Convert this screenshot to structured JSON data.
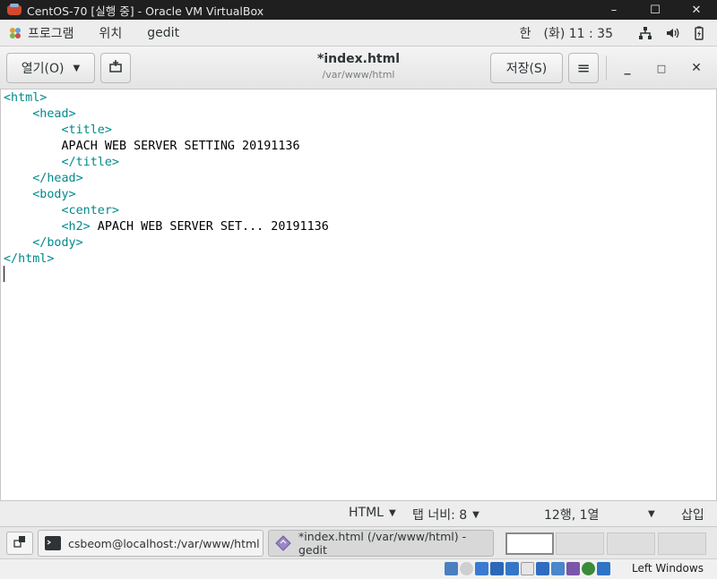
{
  "vbox": {
    "title": "CentOS-70 [실행 중] - Oracle VM VirtualBox",
    "minimize": "–",
    "maximize": "☐",
    "close": "✕"
  },
  "gnome_topbar": {
    "menus": [
      "프로그램",
      "위치",
      "gedit"
    ],
    "input_method": "한",
    "clock": "(화) 11 : 35"
  },
  "headerbar": {
    "open_label": "열기(O)",
    "open_caret": "▼",
    "save_label": "저장(S)",
    "doc_name": "*index.html",
    "doc_path": "/var/www/html",
    "menu_glyph": "≡",
    "min_glyph": "_",
    "max_glyph": "□",
    "close_glyph": "✕"
  },
  "editor": {
    "lines": [
      {
        "indent": "",
        "tag": "<html>",
        "text": ""
      },
      {
        "indent": "    ",
        "tag": "<head>",
        "text": ""
      },
      {
        "indent": "        ",
        "tag": "<title>",
        "text": ""
      },
      {
        "indent": "        ",
        "tag": "",
        "text": "APACH WEB SERVER SETTING 20191136"
      },
      {
        "indent": "        ",
        "tag": "</title>",
        "text": ""
      },
      {
        "indent": "    ",
        "tag": "</head>",
        "text": ""
      },
      {
        "indent": "    ",
        "tag": "<body>",
        "text": ""
      },
      {
        "indent": "        ",
        "tag": "<center>",
        "text": ""
      },
      {
        "indent": "        ",
        "tag": "<h2>",
        "text": " APACH WEB SERVER SET... 20191136"
      },
      {
        "indent": "    ",
        "tag": "</body>",
        "text": ""
      },
      {
        "indent": "",
        "tag": "</html>",
        "text": ""
      },
      {
        "indent": "",
        "tag": "",
        "text": ""
      }
    ]
  },
  "statusbar": {
    "language": "HTML",
    "tab_width": "탭 너비: 8",
    "position": "12행, 1열",
    "insert_mode": "삽입",
    "caret": "▼"
  },
  "windowlist": {
    "tasks": [
      {
        "label": "csbeom@localhost:/var/www/html"
      },
      {
        "label": "*index.html (/var/www/html) - gedit"
      }
    ]
  },
  "vbox_status": {
    "host_key": "Left Windows"
  },
  "colors": {
    "tag": "#008a8c",
    "text": "#000000"
  }
}
